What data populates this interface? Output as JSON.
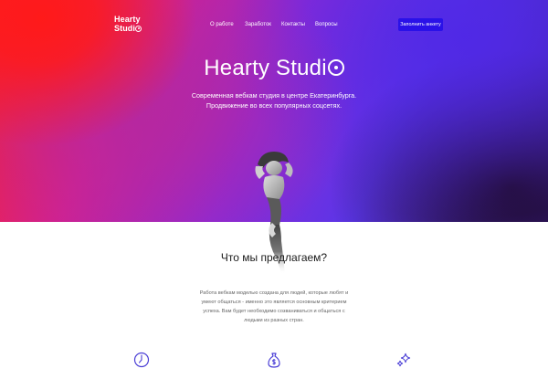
{
  "brand": {
    "line1": "Hearty",
    "line2": "Studi"
  },
  "nav": [
    {
      "label": "О работе"
    },
    {
      "label": "Заработок"
    },
    {
      "label": "Контакты"
    },
    {
      "label": "Вопросы"
    }
  ],
  "cta_label": "Заполнить анкету",
  "hero": {
    "title": "Hearty Studi",
    "subtitle_line1": "Современная вебкам студия в центре Екатеринбурга.",
    "subtitle_line2": "Продвижение во всех популярных соцсетях."
  },
  "section": {
    "title": "Что мы предлагаем?",
    "body_line1": "Работа вебкам моделью создана для людей, которые любят и",
    "body_line2": "умеют общаться - именно это является основным критерием",
    "body_line3": "успеха. Вам будет необходимо созваниваться и общаться с",
    "body_line4": "людьми из разных стран."
  },
  "features": [
    {
      "icon": "clock-icon"
    },
    {
      "icon": "money-bag-icon"
    },
    {
      "icon": "sparkles-icon"
    }
  ],
  "colors": {
    "accent": "#2a11e8",
    "icon": "#4b3fd6"
  }
}
